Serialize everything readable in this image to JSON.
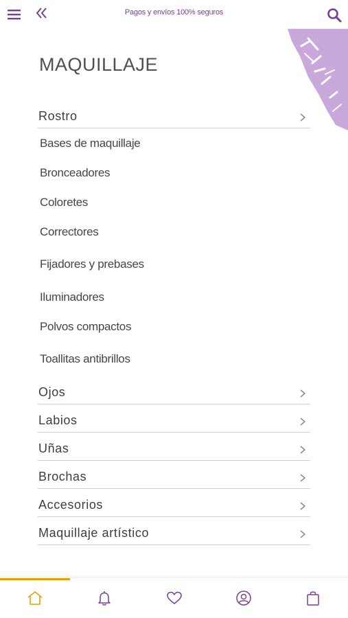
{
  "header": {
    "promo_text": "Pagos y envíos 100% seguros",
    "icons": [
      "menu-icon",
      "double-chevron-left-icon",
      "search-icon"
    ]
  },
  "page": {
    "title": "MAQUILLAJE"
  },
  "menu": {
    "rostro": {
      "label": "Rostro",
      "subitems": [
        "Bases de maquillaje",
        "Bronceadores",
        "Coloretes",
        "Correctores",
        "Fijadores y prebases",
        "Iluminadores",
        "Polvos compactos",
        "Toallitas antibrillos"
      ]
    },
    "categories": [
      "Ojos",
      "Labios",
      "Uñas",
      "Brochas",
      "Accesorios",
      "Maquillaje artístico"
    ]
  },
  "tabbar": {
    "tabs": [
      "home-icon",
      "bell-icon",
      "heart-icon",
      "user-circle-icon",
      "shopping-bag-icon"
    ],
    "active": "home-icon"
  },
  "colors": {
    "brand_purple": "#7a3f93",
    "active_orange": "#e5a100",
    "deco_lilac": "#c9a9dc"
  }
}
